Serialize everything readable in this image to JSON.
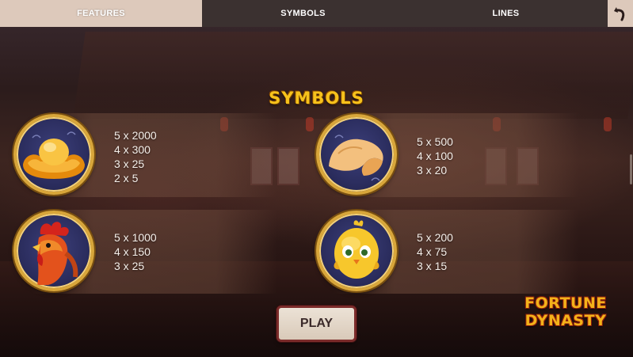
{
  "nav": {
    "tabs": [
      {
        "label": "FEATURES",
        "active": true
      },
      {
        "label": "SYMBOLS",
        "active": false
      },
      {
        "label": "LINES",
        "active": false
      }
    ],
    "back_icon": "back-arrow-icon"
  },
  "heading": "SYMBOLS",
  "symbols": [
    {
      "icon": "gold-ingot-icon",
      "pays": [
        "5 x 2000",
        "4 x 300",
        "3 x 25",
        "2 x 5"
      ]
    },
    {
      "icon": "fortune-cookie-icon",
      "pays": [
        "5 x 500",
        "4 x 100",
        "3 x 20"
      ]
    },
    {
      "icon": "rooster-icon",
      "pays": [
        "5 x 1000",
        "4 x 150",
        "3 x 25"
      ]
    },
    {
      "icon": "chick-icon",
      "pays": [
        "5 x 200",
        "4 x 75",
        "3 x 15"
      ]
    }
  ],
  "play_label": "PLAY",
  "logo": {
    "line1": "FORTUNE",
    "line2": "DYNASTY"
  },
  "colors": {
    "accent_gold": "#f6c21c",
    "tab_active_bg": "#ddc9bb",
    "tab_inactive_bg": "#3b3130",
    "medal_rim": "#d8a63a",
    "button_border": "#7b2b2a"
  }
}
